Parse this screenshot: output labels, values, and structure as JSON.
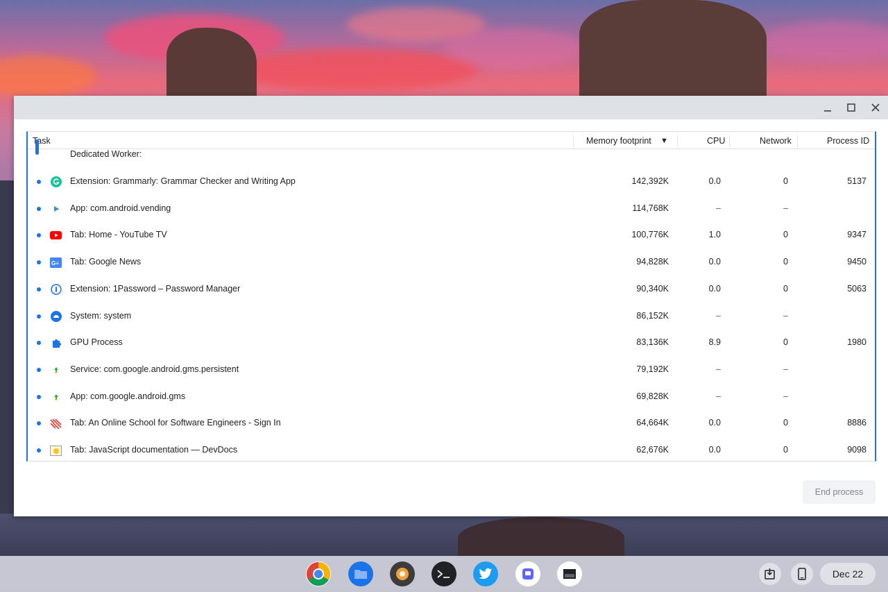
{
  "table": {
    "headers": {
      "task": "Task",
      "memory": "Memory footprint",
      "sort_indicator": "▼",
      "cpu": "CPU",
      "network": "Network",
      "pid": "Process ID"
    },
    "rows": [
      {
        "icon": "worker-icon",
        "name": "Dedicated Worker:",
        "memory": "",
        "cpu": "",
        "network": "",
        "pid": ""
      },
      {
        "icon": "grammarly-icon",
        "name": "Extension: Grammarly: Grammar Checker and Writing App",
        "memory": "142,392K",
        "cpu": "0.0",
        "network": "0",
        "pid": "5137"
      },
      {
        "icon": "play-store-icon",
        "name": "App: com.android.vending",
        "memory": "114,768K",
        "cpu": "–",
        "network": "–",
        "pid": ""
      },
      {
        "icon": "youtube-icon",
        "name": "Tab: Home - YouTube TV",
        "memory": "100,776K",
        "cpu": "1.0",
        "network": "0",
        "pid": "9347"
      },
      {
        "icon": "google-news-icon",
        "name": "Tab: Google News",
        "memory": "94,828K",
        "cpu": "0.0",
        "network": "0",
        "pid": "9450"
      },
      {
        "icon": "1password-icon",
        "name": "Extension: 1Password – Password Manager",
        "memory": "90,340K",
        "cpu": "0.0",
        "network": "0",
        "pid": "5063"
      },
      {
        "icon": "system-icon",
        "name": "System: system",
        "memory": "86,152K",
        "cpu": "–",
        "network": "–",
        "pid": ""
      },
      {
        "icon": "puzzle-icon",
        "name": "GPU Process",
        "memory": "83,136K",
        "cpu": "8.9",
        "network": "0",
        "pid": "1980"
      },
      {
        "icon": "android-icon",
        "name": "Service: com.google.android.gms.persistent",
        "memory": "79,192K",
        "cpu": "–",
        "network": "–",
        "pid": ""
      },
      {
        "icon": "android-icon",
        "name": "App: com.google.android.gms",
        "memory": "69,828K",
        "cpu": "–",
        "network": "–",
        "pid": ""
      },
      {
        "icon": "school-icon",
        "name": "Tab: An Online School for Software Engineers - Sign In",
        "memory": "64,664K",
        "cpu": "0.0",
        "network": "0",
        "pid": "8886"
      },
      {
        "icon": "devdocs-icon",
        "name": "Tab: JavaScript documentation — DevDocs",
        "memory": "62,676K",
        "cpu": "0.0",
        "network": "0",
        "pid": "9098"
      }
    ]
  },
  "end_process_label": "End process",
  "shelf": {
    "apps": [
      "chrome-icon",
      "files-icon",
      "app-icon",
      "terminal-icon",
      "twitter-icon",
      "mastodon-icon",
      "screenshot-icon"
    ],
    "date": "Dec 22"
  },
  "colors": {
    "accent": "#1a73e8",
    "titlebar": "#dee1e6"
  }
}
